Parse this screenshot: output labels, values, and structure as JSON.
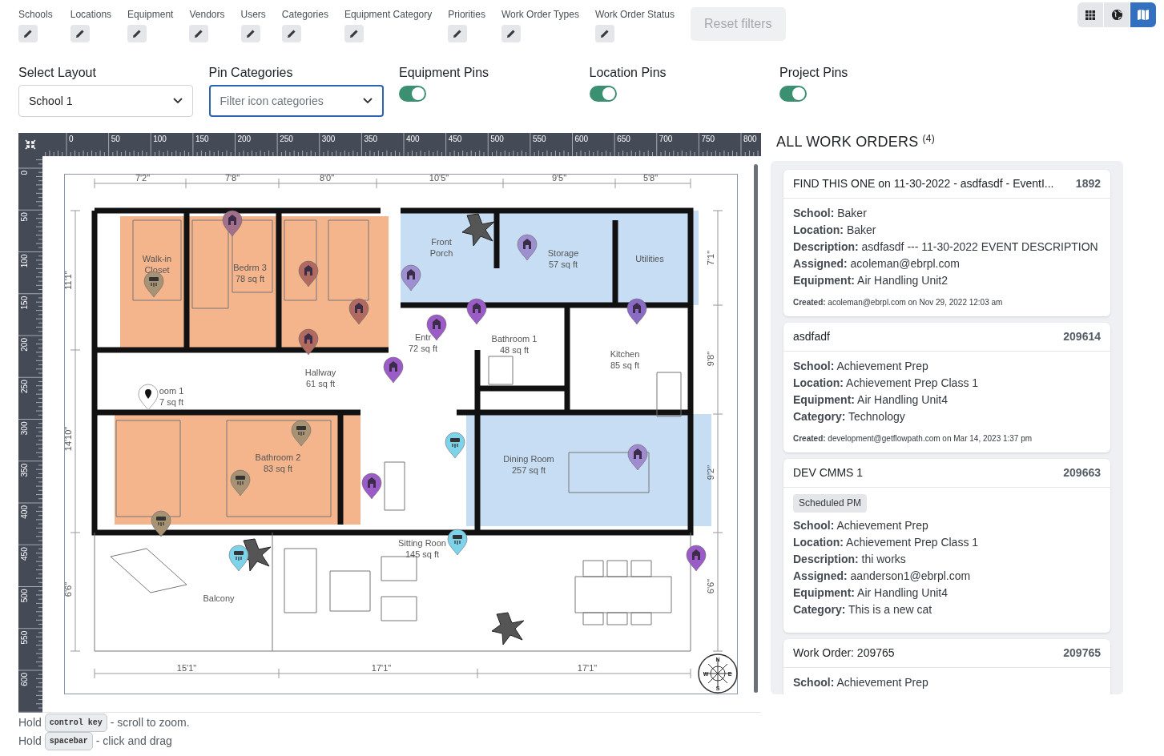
{
  "filters": [
    {
      "label": "Schools"
    },
    {
      "label": "Locations"
    },
    {
      "label": "Equipment"
    },
    {
      "label": "Vendors"
    },
    {
      "label": "Users"
    },
    {
      "label": "Categories"
    },
    {
      "label": "Equipment Category"
    },
    {
      "label": "Priorities"
    },
    {
      "label": "Work Order Types"
    },
    {
      "label": "Work Order Status"
    }
  ],
  "reset_button": {
    "label": "Reset filters",
    "disabled": true
  },
  "view_toggle": [
    {
      "kind": "table",
      "selected": false
    },
    {
      "kind": "globe",
      "selected": false
    },
    {
      "kind": "map",
      "selected": true
    }
  ],
  "layout_select": {
    "label": "Select Layout",
    "value": "School 1"
  },
  "pin_categories": {
    "label": "Pin Categories",
    "placeholder": "Filter icon categories"
  },
  "toggles": [
    {
      "label": "Equipment Pins",
      "on": true
    },
    {
      "label": "Location Pins",
      "on": true
    },
    {
      "label": "Project Pins",
      "on": true
    }
  ],
  "ruler": {
    "x_labels": [
      "0",
      "50",
      "100",
      "150",
      "200",
      "250",
      "300",
      "350",
      "400",
      "450",
      "500",
      "550",
      "600",
      "650",
      "700",
      "750",
      "800"
    ],
    "y_labels": [
      "0",
      "50",
      "100",
      "150",
      "200",
      "250",
      "300",
      "350",
      "400",
      "450",
      "500",
      "550",
      "600"
    ]
  },
  "floor_plan": {
    "zones": [
      {
        "color": "#f4b48c"
      },
      {
        "color": "#f4b48c"
      },
      {
        "color": "#c6ddf4"
      },
      {
        "color": "#c6ddf4"
      }
    ],
    "rooms": [
      {
        "lines": [
          "Walk-in",
          "Closet"
        ]
      },
      {
        "lines": [
          "Bedrm 3",
          "78 sq ft"
        ]
      },
      {
        "lines": [
          "Front",
          "Porch"
        ]
      },
      {
        "lines": [
          "Storage",
          "57 sq ft"
        ]
      },
      {
        "lines": [
          "Utilities"
        ]
      },
      {
        "lines": [
          "Entr",
          "72 sq ft"
        ]
      },
      {
        "lines": [
          "Bathroom 1",
          "48 sq ft"
        ]
      },
      {
        "lines": [
          "Kitchen",
          "85 sq ft"
        ]
      },
      {
        "lines": [
          "Hallway",
          "61 sq ft"
        ]
      },
      {
        "lines": [
          "oom 1",
          "7 sq ft"
        ]
      },
      {
        "lines": [
          "Bathroom 2",
          "83 sq ft"
        ]
      },
      {
        "lines": [
          "Dining Room",
          "257 sq ft"
        ]
      },
      {
        "lines": [
          "Sitting Roon",
          "145 sq ft"
        ]
      },
      {
        "lines": [
          "Balcony"
        ]
      }
    ],
    "dimensions": {
      "top": [
        "7'2\"",
        "7'8\"",
        "8'0\"",
        "10'5\"",
        "9'5\"",
        "5'8\""
      ],
      "bottom": [
        "15'1\"",
        "17'1\"",
        "17'1\""
      ],
      "left": [
        "11'1\"",
        "14'10\"",
        "6'6\""
      ],
      "right": [
        "7'1\"",
        "9'8\"",
        "9'2\"",
        "6'6\""
      ]
    },
    "compass": [
      "N",
      "E",
      "S",
      "W"
    ],
    "pins": [
      {
        "kind": "location",
        "color": "#a2708a"
      },
      {
        "kind": "equipment",
        "color": "#a89274"
      },
      {
        "kind": "location",
        "color": "#b06a60"
      },
      {
        "kind": "location",
        "color": "#b06a60"
      },
      {
        "kind": "location",
        "color": "#b06a60"
      },
      {
        "kind": "location",
        "color": "#9d8fd0"
      },
      {
        "kind": "location",
        "color": "#9d8fd0"
      },
      {
        "kind": "location",
        "color": "#8a6cc4"
      },
      {
        "kind": "location",
        "color": "#9b5cc8"
      },
      {
        "kind": "location",
        "color": "#9b5cc8"
      },
      {
        "kind": "location",
        "color": "#9b5cc8"
      },
      {
        "kind": "marker",
        "color": "#ffffff"
      },
      {
        "kind": "equipment",
        "color": "#a89274"
      },
      {
        "kind": "equipment",
        "color": "#a89274"
      },
      {
        "kind": "equipment",
        "color": "#a89274"
      },
      {
        "kind": "equipment",
        "color": "#7dd3ea"
      },
      {
        "kind": "location",
        "color": "#a08ad0"
      },
      {
        "kind": "location",
        "color": "#9b5cc8"
      },
      {
        "kind": "equipment",
        "color": "#7dd3ea"
      },
      {
        "kind": "equipment",
        "color": "#7dd3ea"
      },
      {
        "kind": "location",
        "color": "#9b5cc8"
      }
    ]
  },
  "hints": [
    {
      "before": "Hold",
      "key": "control key",
      "after": "- scroll to zoom."
    },
    {
      "before": "Hold",
      "key": "spacebar",
      "after": "- click and drag"
    }
  ],
  "work_orders": {
    "title": "ALL WORK ORDERS",
    "count": "(4)",
    "items": [
      {
        "title": "FIND THIS ONE on 11-30-2022 - asdfasdf - EventI...",
        "number": "1892",
        "fields": [
          "**School:** Baker",
          "**Location:** Baker",
          "**Description:** asdfasdf --- 11-30-2022 EVENT DESCRIPTION",
          "**Assigned:** acoleman@ebrpl.com",
          "**Equipment:** Air Handling Unit2"
        ],
        "created": "**Created:** acoleman@ebrpl.com on Nov 29, 2022 12:03 am"
      },
      {
        "title": "asdfadf",
        "number": "209614",
        "fields": [
          "**School:** Achievement Prep",
          "**Location:** Achievement Prep Class 1",
          "**Equipment:** Air Handling Unit4",
          "**Category:** Technology"
        ],
        "created": "**Created:** development@getflowpath.com on Mar 14, 2023 1:37 pm"
      },
      {
        "title": "DEV CMMS 1",
        "number": "209663",
        "tag": "Scheduled PM",
        "fields": [
          "**School:** Achievement Prep",
          "**Location:** Achievement Prep Class 1",
          "**Description:** thi works",
          "**Assigned:** aanderson1@ebrpl.com",
          "**Equipment:** Air Handling Unit4",
          "**Category:** This is a new cat"
        ]
      },
      {
        "title": "Work Order: 209765",
        "number": "209765",
        "fields": [
          "**School:** Achievement Prep"
        ]
      }
    ]
  }
}
